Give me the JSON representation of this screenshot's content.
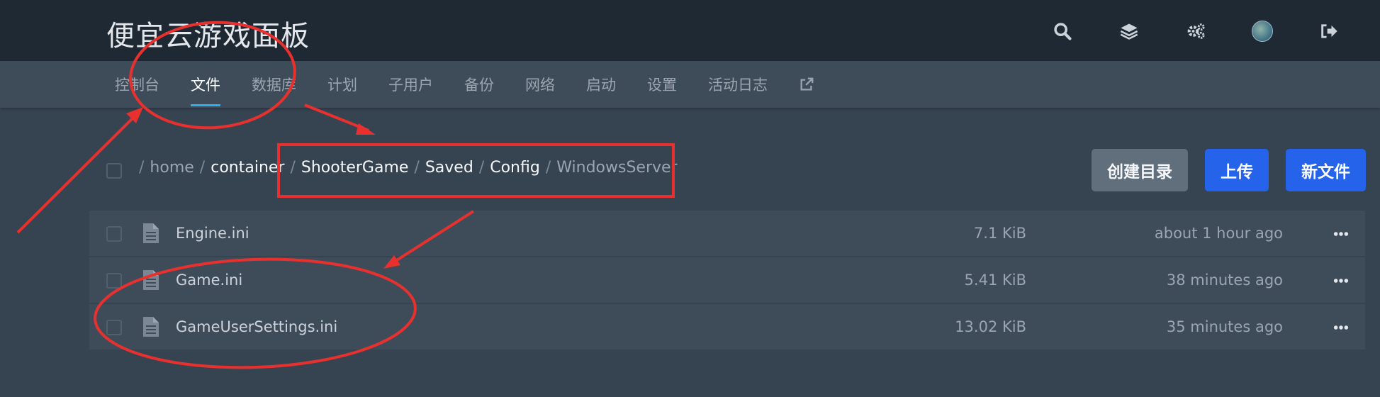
{
  "app": {
    "title": "便宜云游戏面板"
  },
  "topbar": {
    "icons": [
      "search-icon",
      "layers-icon",
      "gears-icon",
      "avatar",
      "sign-out-icon"
    ]
  },
  "nav": {
    "items": [
      {
        "label": "控制台"
      },
      {
        "label": "文件"
      },
      {
        "label": "数据库"
      },
      {
        "label": "计划"
      },
      {
        "label": "子用户"
      },
      {
        "label": "备份"
      },
      {
        "label": "网络"
      },
      {
        "label": "启动"
      },
      {
        "label": "设置"
      },
      {
        "label": "活动日志"
      }
    ],
    "active_index": 1,
    "external_icon": "external-link-icon"
  },
  "breadcrumb": {
    "parts": [
      "home",
      "container",
      "ShooterGame",
      "Saved",
      "Config",
      "WindowsServer"
    ]
  },
  "actions": {
    "create_dir": "创建目录",
    "upload": "上传",
    "new_file": "新文件"
  },
  "files": [
    {
      "name": "Engine.ini",
      "size": "7.1 KiB",
      "modified": "about 1 hour ago"
    },
    {
      "name": "Game.ini",
      "size": "5.41 KiB",
      "modified": "38 minutes ago"
    },
    {
      "name": "GameUserSettings.ini",
      "size": "13.02 KiB",
      "modified": "35 minutes ago"
    }
  ],
  "colors": {
    "accent": "#2bb0ed",
    "primary_button": "#2563eb",
    "annotation": "#e8312e"
  }
}
